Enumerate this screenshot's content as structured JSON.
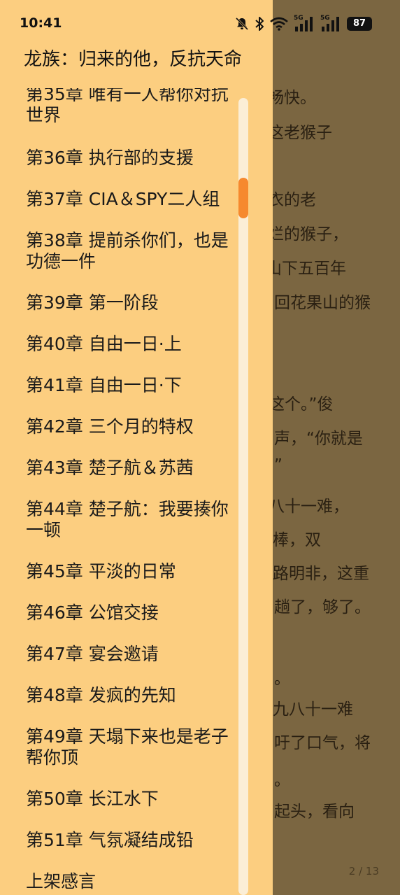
{
  "status_bar": {
    "time": "10:41",
    "icons": [
      "mute-bell-icon",
      "bluetooth-icon",
      "wifi-icon",
      "signal-5g-icon",
      "signal-5g-icon"
    ],
    "signal_label_1": "5G",
    "signal_label_2": "5G",
    "battery": "87"
  },
  "book": {
    "title": "龙族：归来的他，反抗天命"
  },
  "chapters": [
    "第35章 唯有一人帮你对抗世界",
    "第36章 执行部的支援",
    "第37章 CIA＆SPY二人组",
    "第38章 提前杀你们，也是功德一件",
    "第39章 第一阶段",
    "第40章 自由一日·上",
    "第41章 自由一日·下",
    "第42章 三个月的特权",
    "第43章 楚子航＆苏茜",
    "第44章 楚子航：我要揍你一顿",
    "第45章 平淡的日常",
    "第46章 公馆交接",
    "第47章 宴会邀请",
    "第48章 发疯的先知",
    "第49章 天塌下来也是老子帮你顶",
    "第50章 长江水下",
    "第51章 气氛凝结成铅",
    "上架感言"
  ],
  "reader": {
    "lines": [
      "又畅快。",
      "要这老猴子",
      "布衣的老",
      "灿烂的猴子，",
      "山下五百年",
      "回花果山的猴",
      "这个。”俊",
      "声，“你就是",
      "”",
      "八十一难，",
      "棒，双",
      "路明非，这重",
      "趟了，够了。",
      "。",
      "九八十一难",
      "吁了口气，将",
      "。",
      "起头，看向"
    ],
    "page_indicator": "2 / 13"
  },
  "colors": {
    "drawer_bg": "#fcce80",
    "overlay": "#7b6641",
    "scroll_thumb": "#f6892e"
  }
}
